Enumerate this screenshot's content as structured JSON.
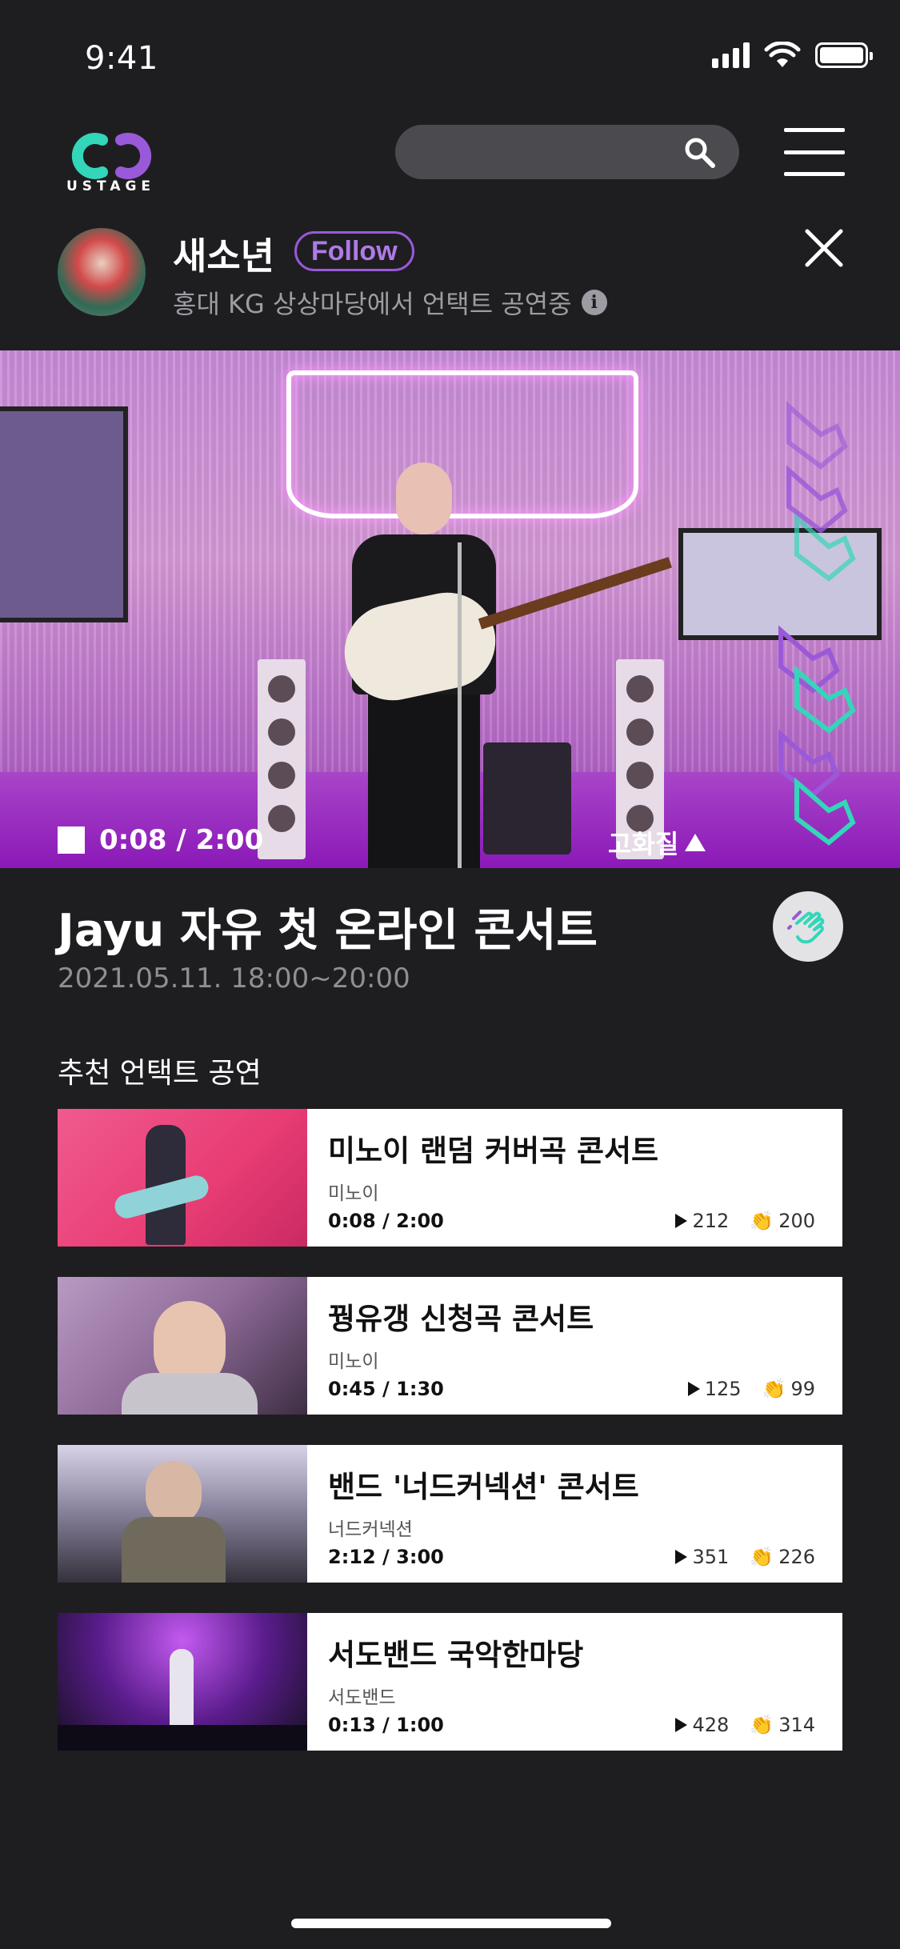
{
  "status_bar": {
    "time": "9:41"
  },
  "header": {
    "logo_text": "USTAGE",
    "search_placeholder": ""
  },
  "artist": {
    "name": "새소년",
    "follow_label": "Follow",
    "subtitle": "홍대 KG 상상마당에서 언택트 공연중"
  },
  "player": {
    "time": "0:08 / 2:00",
    "quality_label": "고화질"
  },
  "concert": {
    "title": "Jayu 자유 첫 온라인 콘서트",
    "date": "2021.05.11. 18:00~20:00"
  },
  "recommend": {
    "section_title": "추천 언택트 공연",
    "items": [
      {
        "title": "미노이 랜덤 커버곡 콘서트",
        "artist": "미노이",
        "time": "0:08 / 2:00",
        "plays": "212",
        "claps": "200"
      },
      {
        "title": "꿩유갱 신청곡 콘서트",
        "artist": "미노이",
        "time": "0:45 / 1:30",
        "plays": "125",
        "claps": "99"
      },
      {
        "title": "밴드 '너드커넥션' 콘서트",
        "artist": "너드커넥션",
        "time": "2:12 / 3:00",
        "plays": "351",
        "claps": "226"
      },
      {
        "title": "서도밴드 국악한마당",
        "artist": "서도밴드",
        "time": "0:13 / 1:00",
        "plays": "428",
        "claps": "314"
      }
    ]
  },
  "colors": {
    "background": "#1e1e21",
    "accent_purple": "#9a59d8",
    "accent_teal": "#33d6b8",
    "card_bg": "#ffffff"
  },
  "icons": [
    "search-icon",
    "menu-icon",
    "close-icon",
    "info-icon",
    "stop-icon",
    "clap-icon",
    "play-icon"
  ]
}
